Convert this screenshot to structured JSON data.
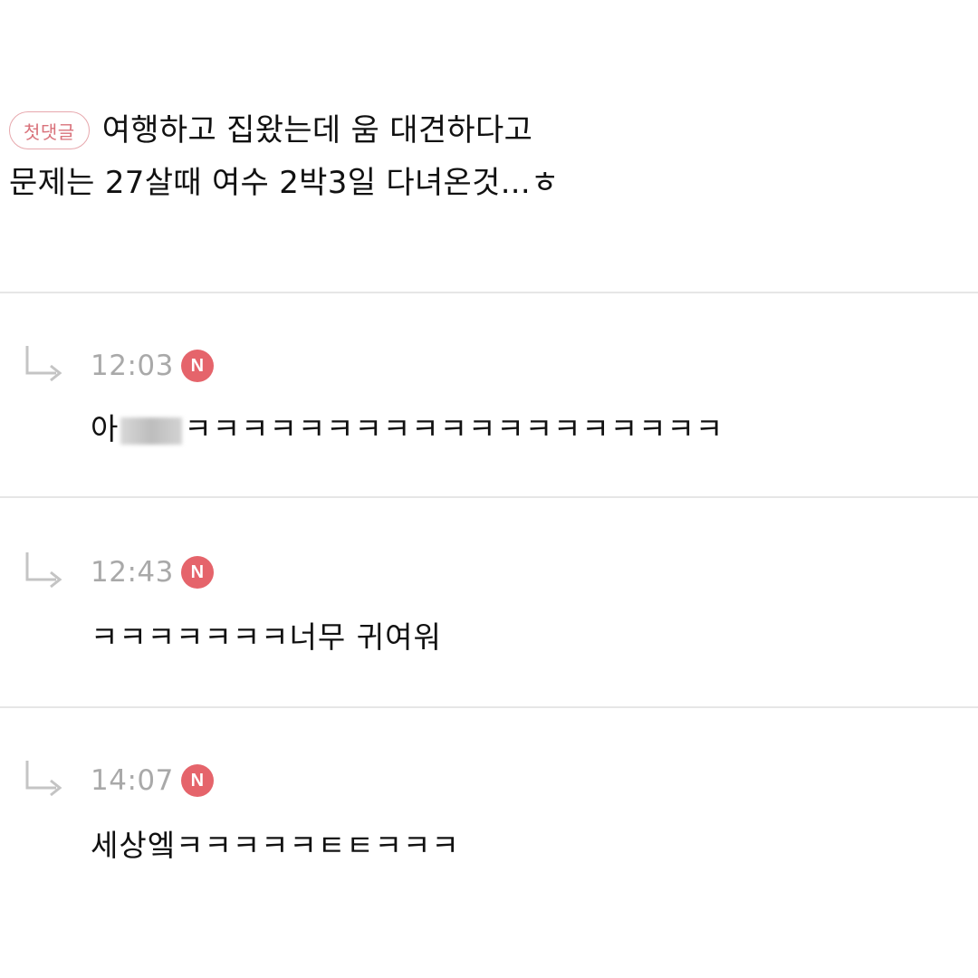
{
  "post": {
    "badge": "첫댓글",
    "line1": "여행하고 집왔는데 움 대견하다고",
    "line2": "문제는 27살때 여수 2박3일 다녀온것...ㅎ"
  },
  "replies": [
    {
      "time": "12:03",
      "new_badge": "N",
      "text_start": "아",
      "text_end": "ㅋㅋㅋㅋㅋㅋㅋㅋㅋㅋㅋㅋㅋㅋㅋㅋㅋㅋㅋ"
    },
    {
      "time": "12:43",
      "new_badge": "N",
      "text": "ㅋㅋㅋㅋㅋㅋㅋ너무 귀여워"
    },
    {
      "time": "14:07",
      "new_badge": "N",
      "text": "세상엨ㅋㅋㅋㅋㅋㅌㅌㅋㅋㅋ"
    }
  ],
  "colors": {
    "badge_border": "#e7a8ad",
    "badge_text": "#d9727b",
    "new_badge_bg": "#e5646b",
    "time_text": "#a9a9a9",
    "divider": "#e6e6e6"
  },
  "icons": {
    "reply": "reply-arrow-icon",
    "new": "new-badge-icon"
  }
}
